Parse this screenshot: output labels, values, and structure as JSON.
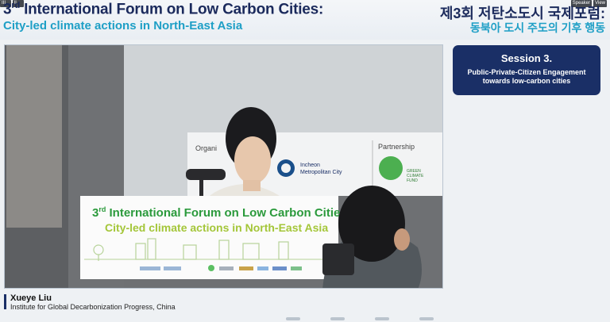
{
  "window": {
    "left_controls": [
      "III",
      "ll"
    ],
    "right_controls": [
      "Speaker",
      "View"
    ]
  },
  "header": {
    "title_en_prefix": "3",
    "title_en_sup": "rd",
    "title_en": " International Forum on Low Carbon Cities:",
    "subtitle_en": "City-led climate actions in North-East Asia",
    "title_ko": "제3회 저탄소도시 국제포럼:",
    "subtitle_ko": "동북아 도시 주도의 기후 행동"
  },
  "session": {
    "title": "Session 3.",
    "description_line1": "Public-Private-Citizen Engagement",
    "description_line2": "towards low-carbon cities"
  },
  "video": {
    "banner_prefix": "3",
    "banner_sup": "rd",
    "banner_title": " International Forum on Low Carbon Cities:",
    "banner_subtitle": "City-led climate actions in North-East Asia",
    "backdrop_organizer_label": "Organi",
    "backdrop_partner_label": "Partnership",
    "backdrop_incheon_line1": "Incheon",
    "backdrop_incheon_line2": "Metropolitan City",
    "backdrop_gcf_line1": "GREEN",
    "backdrop_gcf_line2": "CLIMATE",
    "backdrop_gcf_line3": "FUND"
  },
  "speaker": {
    "name": "Xueye Liu",
    "affiliation": "Institute for Global Decarbonization Progress, China"
  },
  "colors": {
    "navy": "#1a2f66",
    "cyan": "#1e9fc6",
    "banner_green": "#2b9a3c",
    "banner_lime": "#a4c639"
  }
}
